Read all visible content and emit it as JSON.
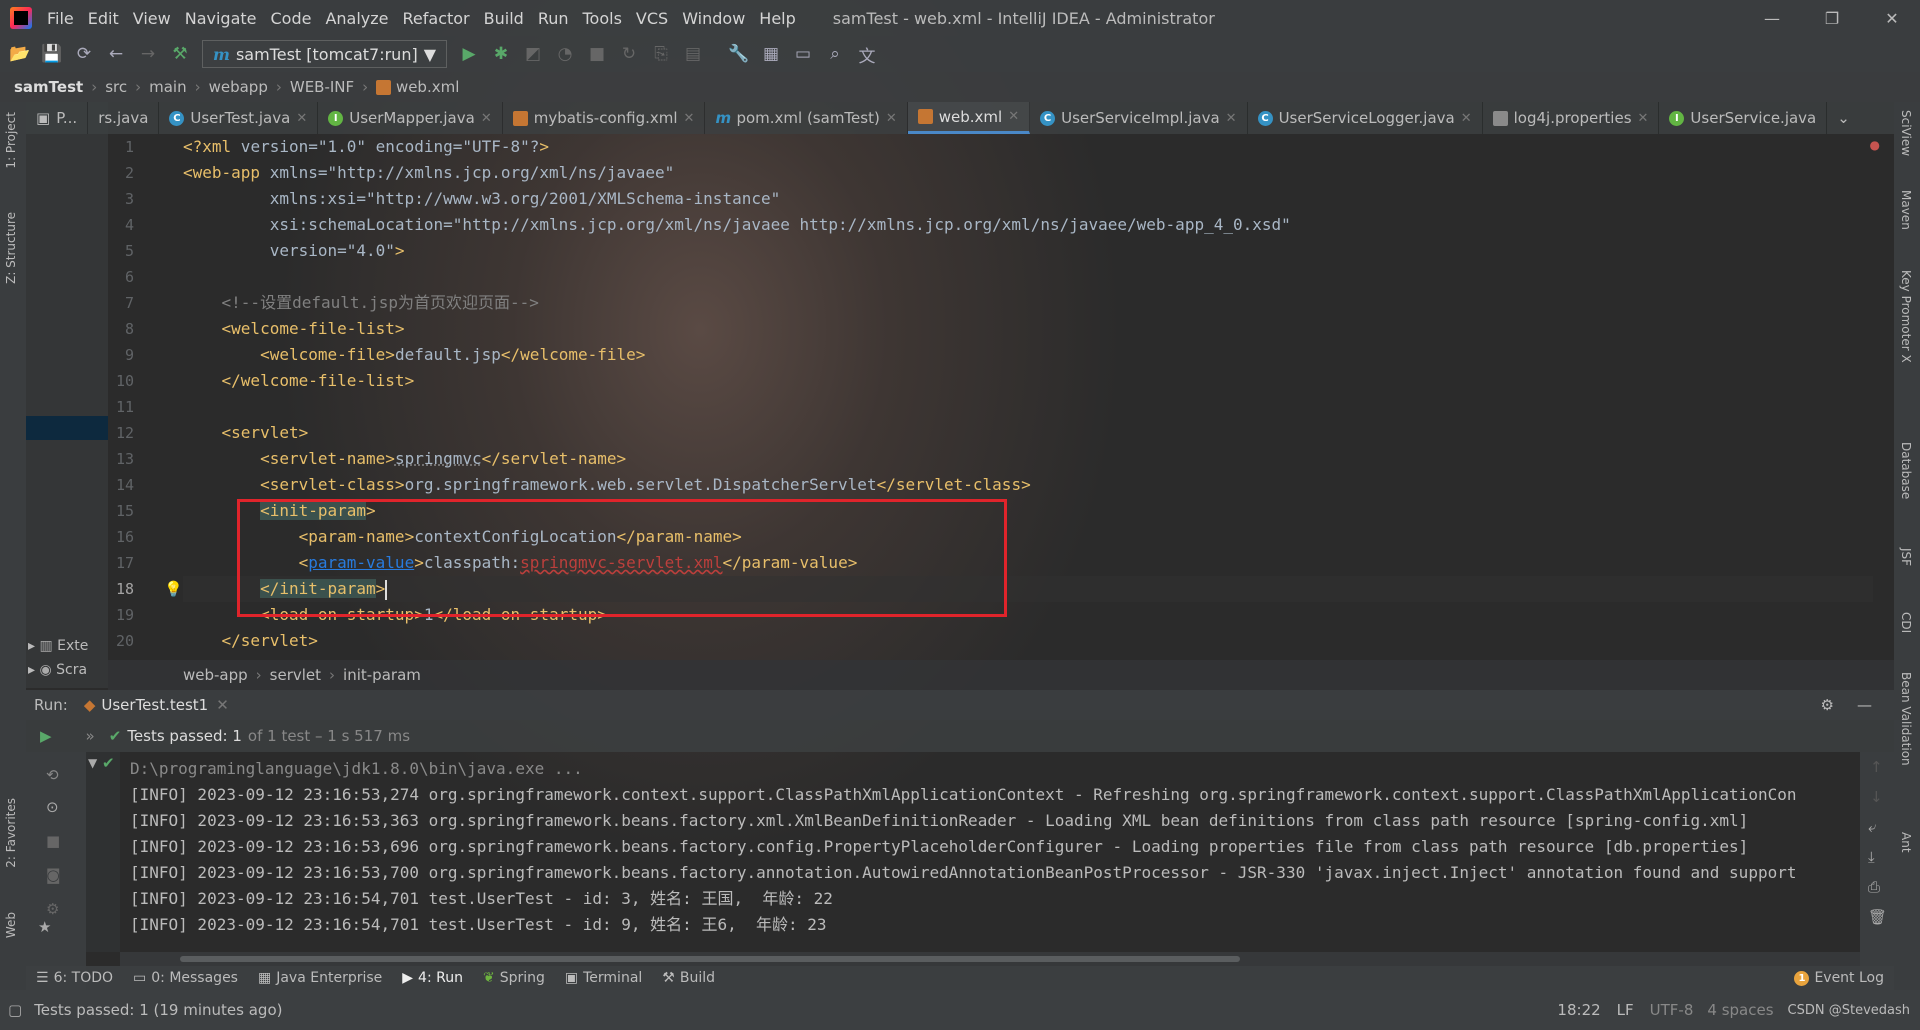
{
  "app": {
    "window_title": "samTest - web.xml - IntelliJ IDEA - Administrator"
  },
  "menu": [
    "File",
    "Edit",
    "View",
    "Navigate",
    "Code",
    "Analyze",
    "Refactor",
    "Build",
    "Run",
    "Tools",
    "VCS",
    "Window",
    "Help"
  ],
  "toolbar": {
    "run_config": "samTest [tomcat7:run]"
  },
  "breadcrumb": [
    "samTest",
    "src",
    "main",
    "webapp",
    "WEB-INF",
    "web.xml"
  ],
  "project_tab": "P...",
  "tabs": [
    {
      "label": "rs.java",
      "icon": "class-icon"
    },
    {
      "label": "UserTest.java",
      "icon": "class-icon"
    },
    {
      "label": "UserMapper.java",
      "icon": "interface-icon"
    },
    {
      "label": "mybatis-config.xml",
      "icon": "xml-icon"
    },
    {
      "label": "pom.xml (samTest)",
      "icon": "maven-icon"
    },
    {
      "label": "web.xml",
      "icon": "xml-icon",
      "active": true
    },
    {
      "label": "UserServiceImpl.java",
      "icon": "class-icon"
    },
    {
      "label": "UserServiceLogger.java",
      "icon": "class-icon"
    },
    {
      "label": "log4j.properties",
      "icon": "properties-icon"
    },
    {
      "label": "UserService.java",
      "icon": "interface-icon"
    }
  ],
  "editor": {
    "line_numbers": [
      "1",
      "2",
      "3",
      "4",
      "5",
      "6",
      "7",
      "8",
      "9",
      "10",
      "11",
      "12",
      "13",
      "14",
      "15",
      "16",
      "17",
      "18",
      "19",
      "20"
    ],
    "lines": [
      "<?xml version=\"1.0\" encoding=\"UTF-8\"?>",
      "<web-app xmlns=\"http://xmlns.jcp.org/xml/ns/javaee\"",
      "         xmlns:xsi=\"http://www.w3.org/2001/XMLSchema-instance\"",
      "         xsi:schemaLocation=\"http://xmlns.jcp.org/xml/ns/javaee http://xmlns.jcp.org/xml/ns/javaee/web-app_4_0.xsd\"",
      "         version=\"4.0\">",
      "",
      "    <!--设置default.jsp为首页欢迎页面-->",
      "    <welcome-file-list>",
      "        <welcome-file>default.jsp</welcome-file>",
      "    </welcome-file-list>",
      "",
      "    <servlet>",
      "        <servlet-name>springmvc</servlet-name>",
      "        <servlet-class>org.springframework.web.servlet.DispatcherServlet</servlet-class>",
      "        <init-param>",
      "            <param-name>contextConfigLocation</param-name>",
      "            <param-value>classpath:springmvc-servlet.xml</param-value>",
      "        </init-param>",
      "        <load-on-startup>1</load-on-startup>",
      "    </servlet>"
    ],
    "crumbs": [
      "web-app",
      "servlet",
      "init-param"
    ]
  },
  "project_tree": {
    "items": [
      "Exte",
      "Scra"
    ]
  },
  "run": {
    "label": "Run:",
    "tab": "UserTest.test1",
    "tests_passed": "Tests passed: 1",
    "tests_detail": "of 1 test – 1 s 517 ms",
    "console": [
      "D:\\programinglanguage\\jdk1.8.0\\bin\\java.exe ...",
      "[INFO] 2023-09-12 23:16:53,274 org.springframework.context.support.ClassPathXmlApplicationContext - Refreshing org.springframework.context.support.ClassPathXmlApplicationCon",
      "[INFO] 2023-09-12 23:16:53,363 org.springframework.beans.factory.xml.XmlBeanDefinitionReader - Loading XML bean definitions from class path resource [spring-config.xml]",
      "[INFO] 2023-09-12 23:16:53,696 org.springframework.beans.factory.config.PropertyPlaceholderConfigurer - Loading properties file from class path resource [db.properties]",
      "[INFO] 2023-09-12 23:16:53,700 org.springframework.beans.factory.annotation.AutowiredAnnotationBeanPostProcessor - JSR-330 'javax.inject.Inject' annotation found and support",
      "[INFO] 2023-09-12 23:16:54,701 test.UserTest - id: 3, 姓名: 王国,  年龄: 22",
      "[INFO] 2023-09-12 23:16:54,701 test.UserTest - id: 9, 姓名: 王6,  年龄: 23"
    ]
  },
  "bottom_tabs": [
    "6: TODO",
    "0: Messages",
    "Java Enterprise",
    "4: Run",
    "Spring",
    "Terminal",
    "Build"
  ],
  "event_log": "Event Log",
  "left_tools": [
    "1: Project",
    "Z: Structure",
    "2: Favorites",
    "Web"
  ],
  "right_tools": [
    "SciView",
    "Maven",
    "Key Promoter X",
    "Database",
    "JSF",
    "CDI",
    "Bean Validation",
    "Ant"
  ],
  "status": {
    "message": "Tests passed: 1 (19 minutes ago)",
    "position": "18:22",
    "line_sep": "LF",
    "encoding": "UTF-8",
    "spaces": "4 spaces",
    "watermark": "CSDN @Stevedash"
  }
}
